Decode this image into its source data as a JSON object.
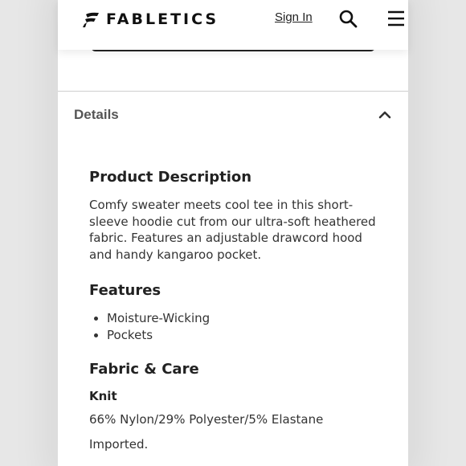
{
  "header": {
    "brand": "FABLETICS",
    "sign_in": "Sign In",
    "icons": [
      "fabletics-logo-icon",
      "search-icon",
      "menu-icon"
    ]
  },
  "details": {
    "label": "Details",
    "expanded": true
  },
  "product": {
    "description_title": "Product Description",
    "description": "Comfy sweater meets cool tee in this short-sleeve hoodie cut from our ultra-soft heathered fabric. Features an adjustable drawcord hood and handy kangaroo pocket.",
    "features_title": "Features",
    "features": [
      "Moisture-Wicking",
      "Pockets"
    ],
    "fabric_title": "Fabric & Care",
    "fabric_type": "Knit",
    "composition": "66% Nylon/29% Polyester/5% Elastane",
    "origin": "Imported."
  },
  "colors": {
    "background": "#e7e7e7",
    "page": "#ffffff",
    "text": "#222222"
  }
}
